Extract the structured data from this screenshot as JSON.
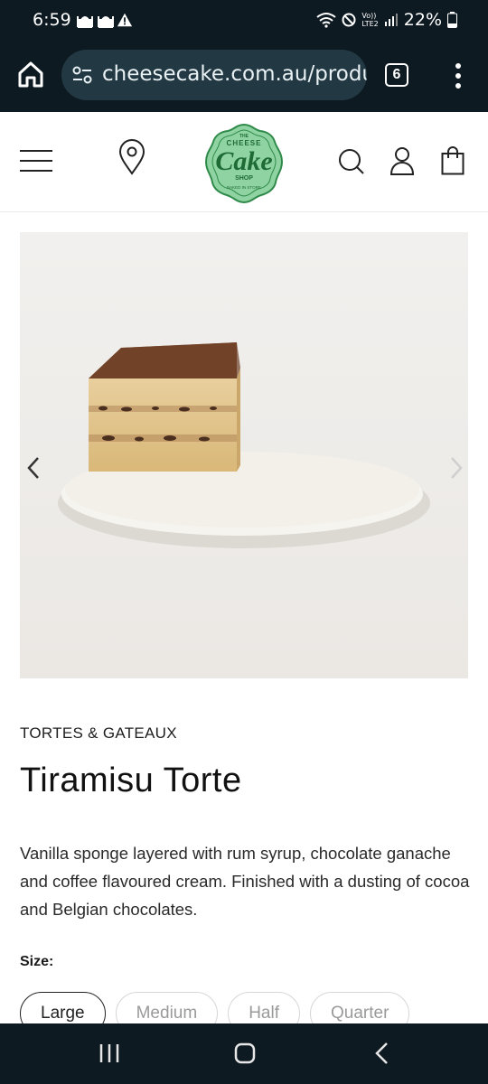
{
  "status_bar": {
    "time": "6:59",
    "battery": "22%",
    "network": "LTE2",
    "volte": "Vo))"
  },
  "browser": {
    "url": "cheesecake.com.au/products/tiramisu-torte",
    "tab_count": "6"
  },
  "site": {
    "logo": {
      "top_text": "THE",
      "line1": "CHEESE",
      "line2": "Cake",
      "line3": "SHOP",
      "bottom_text": "BAKED IN STORE"
    },
    "accent_color": "#2f8a4a"
  },
  "product": {
    "category": "TORTES & GATEAUX",
    "title": "Tiramisu Torte",
    "description": "Vanilla sponge layered with rum syrup, chocolate ganache and coffee flavoured cream. Finished with a dusting of cocoa and Belgian chocolates.",
    "size_label": "Size:",
    "sizes": [
      {
        "label": "Large",
        "selected": true
      },
      {
        "label": "Medium",
        "selected": false
      },
      {
        "label": "Half",
        "selected": false
      },
      {
        "label": "Quarter",
        "selected": false
      }
    ]
  },
  "icons": {
    "header": [
      "menu-icon",
      "location-pin-icon",
      "search-icon",
      "account-icon",
      "shopping-bag-icon"
    ],
    "carousel": [
      "chevron-left-icon",
      "chevron-right-icon"
    ],
    "android_nav": [
      "recent-apps-icon",
      "home-icon",
      "back-icon"
    ]
  }
}
